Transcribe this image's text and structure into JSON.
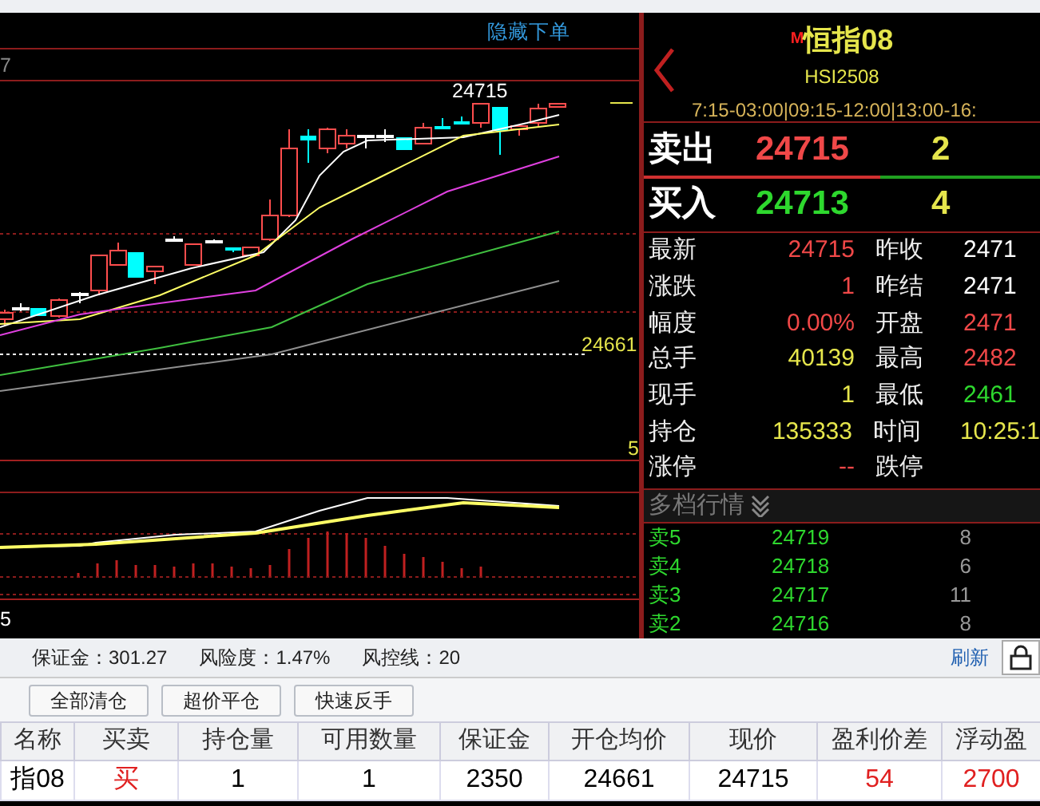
{
  "chart": {
    "hide_order_link": "隐藏下单",
    "top_axis_label": "7",
    "high_label": "24715",
    "position_price": "24661",
    "main_axis_label": "5",
    "indicator_axis_label": "5"
  },
  "quote": {
    "market_mark": "M",
    "name": "恒指08",
    "code": "HSI2508",
    "sessions": "7:15-03:00|09:15-12:00|13:00-16:"
  },
  "ask": {
    "label": "卖出",
    "price": "24715",
    "volume": "2"
  },
  "bid": {
    "label": "买入",
    "price": "24713",
    "volume": "4"
  },
  "stats": [
    {
      "left": {
        "label": "最新",
        "value": "24715",
        "color": "#f04848"
      },
      "right": {
        "label": "昨收",
        "value": "2471",
        "color": "#ffffff"
      }
    },
    {
      "left": {
        "label": "涨跌",
        "value": "1",
        "color": "#f04848"
      },
      "right": {
        "label": "昨结",
        "value": "2471",
        "color": "#ffffff"
      }
    },
    {
      "left": {
        "label": "幅度",
        "value": "0.00%",
        "color": "#f04848"
      },
      "right": {
        "label": "开盘",
        "value": "2471",
        "color": "#f04848"
      }
    },
    {
      "left": {
        "label": "总手",
        "value": "40139",
        "color": "#e6e64c"
      },
      "right": {
        "label": "最高",
        "value": "2482",
        "color": "#f04848"
      }
    },
    {
      "left": {
        "label": "现手",
        "value": "1",
        "color": "#e6e64c"
      },
      "right": {
        "label": "最低",
        "value": "2461",
        "color": "#2ed82e"
      }
    },
    {
      "left": {
        "label": "持仓",
        "value": "135333",
        "color": "#e6e64c"
      },
      "right": {
        "label": "时间",
        "value": "10:25:1",
        "color": "#e6e64c"
      }
    },
    {
      "left": {
        "label": "涨停",
        "value": "--",
        "color": "#f04848"
      },
      "right": {
        "label": "跌停"
      }
    }
  ],
  "depth": {
    "title": "多档行情",
    "levels": [
      {
        "label": "卖5",
        "price": "24719",
        "volume": "8"
      },
      {
        "label": "卖4",
        "price": "24718",
        "volume": "6"
      },
      {
        "label": "卖3",
        "price": "24717",
        "volume": "11"
      },
      {
        "label": "卖2",
        "price": "24716",
        "volume": "8"
      }
    ]
  },
  "account": {
    "items": [
      "保证金：301.27",
      "风险度：1.47%",
      "风控线：20"
    ],
    "refresh": "刷新"
  },
  "actions": [
    "全部清仓",
    "超价平仓",
    "快速反手"
  ],
  "positions": {
    "columns": [
      "名称",
      "买卖",
      "持仓量",
      "可用数量",
      "保证金",
      "开仓均价",
      "现价",
      "盈利价差",
      "浮动盈"
    ],
    "rows": [
      {
        "cells": [
          {
            "text": "指08",
            "color": "#000000"
          },
          {
            "text": "买",
            "color": "#e02020"
          },
          {
            "text": "1",
            "color": "#000000"
          },
          {
            "text": "1",
            "color": "#000000"
          },
          {
            "text": "2350",
            "color": "#000000"
          },
          {
            "text": "24661",
            "color": "#000000"
          },
          {
            "text": "24715",
            "color": "#000000"
          },
          {
            "text": "54",
            "color": "#e02020"
          },
          {
            "text": "2700",
            "color": "#e02020"
          }
        ]
      }
    ]
  }
}
